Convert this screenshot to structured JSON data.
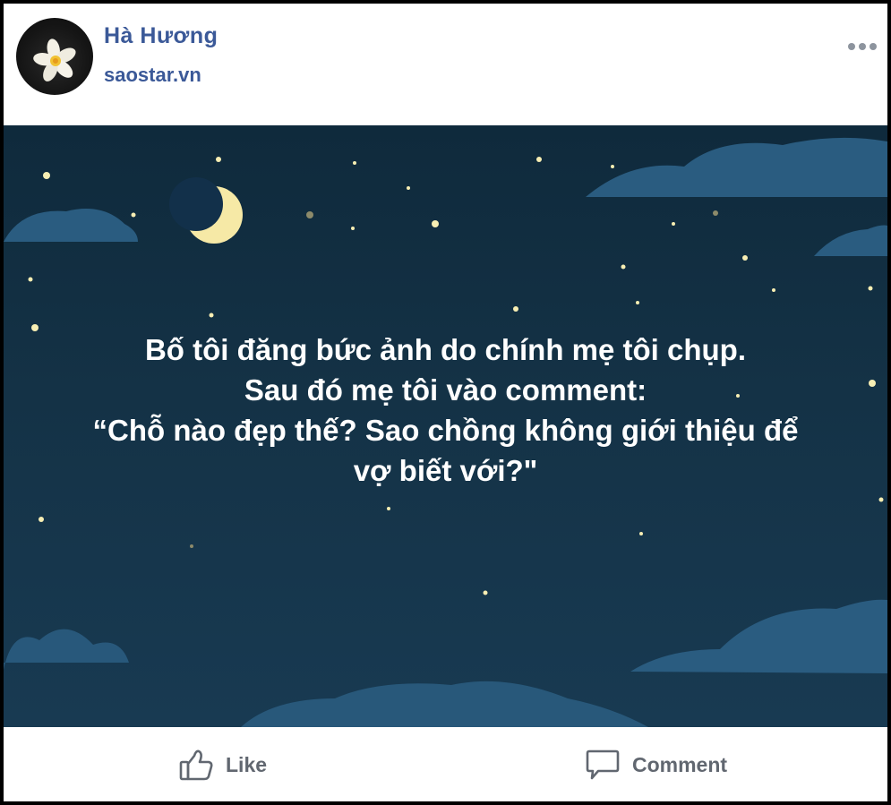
{
  "post": {
    "author_name": "Hà Hương",
    "source_label": "saostar.vn",
    "more_icon": "more-horizontal-icon",
    "image_text_lines": [
      "Bố tôi đăng bức ảnh do chính mẹ tôi chụp.",
      "Sau đó mẹ tôi vào comment:",
      "“Chỗ nào đẹp thế? Sao chồng không giới thiệu để",
      "vợ biết với?\""
    ]
  },
  "actions": {
    "like_label": "Like",
    "like_icon": "thumbs-up-icon",
    "comment_label": "Comment",
    "comment_icon": "comment-bubble-icon"
  },
  "colors": {
    "author_link": "#3b5998",
    "night_sky": "#143246",
    "cloud": "#2a5c80",
    "moon": "#f6e9a6",
    "action_text": "#616770"
  }
}
